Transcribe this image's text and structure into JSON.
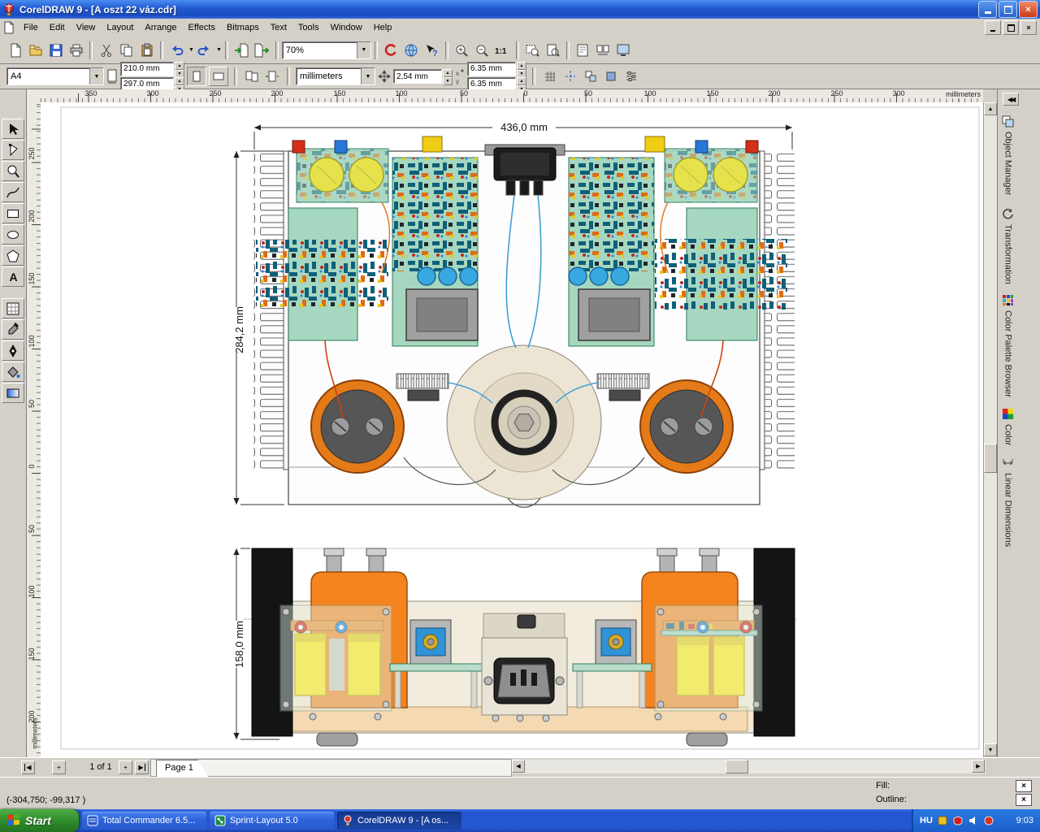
{
  "titlebar": {
    "title": "CorelDRAW 9 - [A oszt 22 váz.cdr]"
  },
  "menu": {
    "items": [
      "File",
      "Edit",
      "View",
      "Layout",
      "Arrange",
      "Effects",
      "Bitmaps",
      "Text",
      "Tools",
      "Window",
      "Help"
    ]
  },
  "standard_toolbar": {
    "zoom_level": "70%"
  },
  "property_bar": {
    "paper_size": "A4",
    "paper_width": "210.0 mm",
    "paper_height": "297.0 mm",
    "units": "millimeters",
    "nudge": "2,54 mm",
    "duplicate_x": "6.35 mm",
    "duplicate_y": "6.35 mm"
  },
  "rulers": {
    "unit_label": "millimeters",
    "v_unit_label": "millimeters",
    "h_labels": [
      "350",
      "300",
      "250",
      "200",
      "150",
      "100",
      "50",
      "0",
      "50",
      "100",
      "150",
      "200",
      "250",
      "300"
    ],
    "v_labels": [
      "250",
      "200",
      "150",
      "100",
      "50",
      "0",
      "50",
      "100",
      "150",
      "200"
    ]
  },
  "canvas": {
    "top_view": {
      "width_dim": "436,0 mm",
      "height_dim": "284,2 mm"
    },
    "front_view": {
      "height_dim": "158,0 mm"
    }
  },
  "dockers": {
    "tabs": [
      "Object Manager",
      "Transformation",
      "Color Palette Browser",
      "Color",
      "Linear Dimensions"
    ]
  },
  "page_bar": {
    "page_indicator": "1 of 1",
    "page_tab_label": "Page 1"
  },
  "status_bar": {
    "cursor_position": "(-304,750; -99,317 )",
    "fill_label": "Fill:",
    "outline_label": "Outline:"
  },
  "taskbar": {
    "start_label": "Start",
    "tasks": [
      {
        "label": "Total Commander 6.5..."
      },
      {
        "label": "Sprint-Layout 5.0"
      },
      {
        "label": "CorelDRAW 9 - [A os..."
      }
    ],
    "language": "HU",
    "clock": "9:03"
  },
  "glyphs": {
    "dropdown": "▼",
    "spin_up": "▲",
    "spin_down": "▼",
    "scroll_left": "◀",
    "scroll_right": "▶",
    "scroll_up": "▲",
    "scroll_down": "▼",
    "close": "×",
    "plus": "+",
    "no_fill": "×",
    "collapse": "◀◀"
  },
  "colors": {
    "titlebar_blue": "#2058d0",
    "taskbar_blue": "#2456cf",
    "start_green": "#2f8c2c",
    "pcb_green": "#a6d7c0",
    "capacitor_orange": "#e47a18",
    "cover_orange": "#f5831e",
    "transformer_yellow": "#ffe80a",
    "ui_gray": "#d4d0c8"
  }
}
